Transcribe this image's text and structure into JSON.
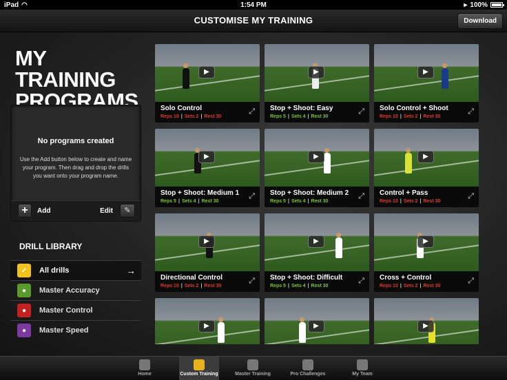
{
  "status_bar": {
    "carrier": "iPad",
    "time": "1:54 PM",
    "battery": "100%",
    "battery_level": 1.0
  },
  "nav": {
    "title": "CUSTOMISE MY TRAINING",
    "download_label": "Download"
  },
  "left": {
    "title": "MY TRAINING PROGRAMS",
    "empty_title": "No programs created",
    "empty_text": "Use the Add button below to create and name your program. Then drag and drop the drills you want onto your program name.",
    "add_label": "Add",
    "edit_label": "Edit"
  },
  "library": {
    "title": "DRILL LIBRARY",
    "items": [
      {
        "label": "All drills",
        "icon": "nike-clapperboard-icon",
        "color": "#f2c21b",
        "active": true
      },
      {
        "label": "Master Accuracy",
        "icon": "accuracy-icon",
        "color": "#5a9a2a",
        "active": false
      },
      {
        "label": "Master Control",
        "icon": "control-icon",
        "color": "#c42222",
        "active": false
      },
      {
        "label": "Master Speed",
        "icon": "speed-icon",
        "color": "#7a3aa0",
        "active": false
      }
    ]
  },
  "drills": [
    {
      "title": "Solo Control",
      "reps": "Reps 10",
      "sets": "Sets 2",
      "rest": "Rest 30",
      "color": "#e23a2a"
    },
    {
      "title": "Stop + Shoot: Easy",
      "reps": "Reps 5",
      "sets": "Sets 4",
      "rest": "Rest 30",
      "color": "#7bc62a"
    },
    {
      "title": "Solo Control + Shoot",
      "reps": "Reps 10",
      "sets": "Sets 2",
      "rest": "Rest 30",
      "color": "#e23a2a"
    },
    {
      "title": "Stop + Shoot: Medium 1",
      "reps": "Reps 5",
      "sets": "Sets 4",
      "rest": "Rest 30",
      "color": "#7bc62a"
    },
    {
      "title": "Stop + Shoot: Medium 2",
      "reps": "Reps 5",
      "sets": "Sets 4",
      "rest": "Rest 30",
      "color": "#7bc62a"
    },
    {
      "title": "Control + Pass",
      "reps": "Reps 10",
      "sets": "Sets 2",
      "rest": "Rest 30",
      "color": "#e23a2a"
    },
    {
      "title": "Directional Control",
      "reps": "Reps 10",
      "sets": "Sets 2",
      "rest": "Rest 30",
      "color": "#e23a2a"
    },
    {
      "title": "Stop + Shoot: Difficult",
      "reps": "Reps 5",
      "sets": "Sets 4",
      "rest": "Rest 30",
      "color": "#7bc62a"
    },
    {
      "title": "Cross + Control",
      "reps": "Reps 10",
      "sets": "Sets 2",
      "rest": "Rest 30",
      "color": "#e23a2a"
    },
    {
      "title": "",
      "reps": "",
      "sets": "",
      "rest": "",
      "color": "#7bc62a"
    },
    {
      "title": "",
      "reps": "",
      "sets": "",
      "rest": "",
      "color": "#7bc62a"
    },
    {
      "title": "",
      "reps": "",
      "sets": "",
      "rest": "",
      "color": "#e23a2a"
    }
  ],
  "tabs": [
    {
      "label": "Home",
      "icon": "home-icon",
      "active": false
    },
    {
      "label": "Custom Training",
      "icon": "custom-training-icon",
      "active": true
    },
    {
      "label": "Master Training",
      "icon": "cone-icon",
      "active": false
    },
    {
      "label": "Pro Challenges",
      "icon": "ball-icon",
      "active": false
    },
    {
      "label": "My Team",
      "icon": "team-icon",
      "active": false
    }
  ]
}
